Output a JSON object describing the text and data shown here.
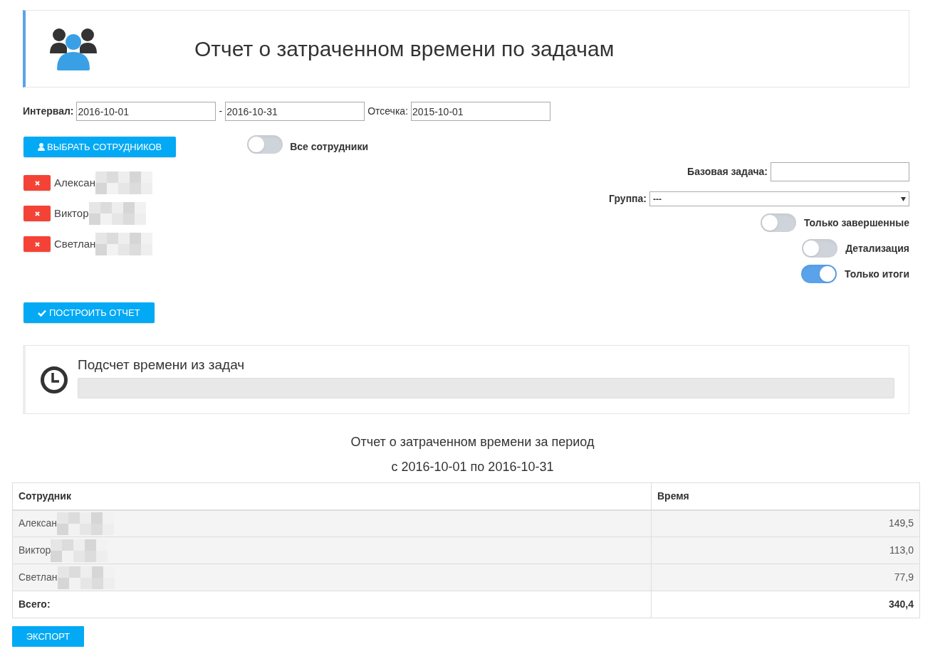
{
  "header": {
    "title": "Отчет о затраченном времени по задачам"
  },
  "interval": {
    "label": "Интервал:",
    "from": "2016-10-01",
    "separator": "-",
    "to": "2016-10-31",
    "cutoff_label": "Отсечка:",
    "cutoff": "2015-10-01"
  },
  "select_button": "ВЫБРАТЬ СОТРУДНИКОВ",
  "all_toggle": {
    "label": "Все сотрудники",
    "on": false
  },
  "employees": [
    {
      "name": "Алексан"
    },
    {
      "name": "Виктор"
    },
    {
      "name": "Светлан"
    }
  ],
  "base_task": {
    "label": "Базовая задача:"
  },
  "group": {
    "label": "Группа:",
    "value": "---"
  },
  "toggles": [
    {
      "label": "Только завершенные",
      "on": false
    },
    {
      "label": "Детализация",
      "on": false
    },
    {
      "label": "Только итоги",
      "on": true
    }
  ],
  "build_button": "ПОСТРОИТЬ ОТЧЕТ",
  "progress": {
    "title": "Подсчет времени из задач"
  },
  "report": {
    "title": "Отчет о затраченном времени за период",
    "subtitle": "с 2016-10-01 по 2016-10-31",
    "columns": [
      "Сотрудник",
      "Время"
    ],
    "rows": [
      {
        "name": "Алексан",
        "time": "149,5"
      },
      {
        "name": "Виктор",
        "time": "113,0"
      },
      {
        "name": "Светлан",
        "time": "77,9"
      }
    ],
    "total": {
      "label": "Всего:",
      "time": "340,4"
    }
  },
  "export_button": "ЭКСПОРТ"
}
